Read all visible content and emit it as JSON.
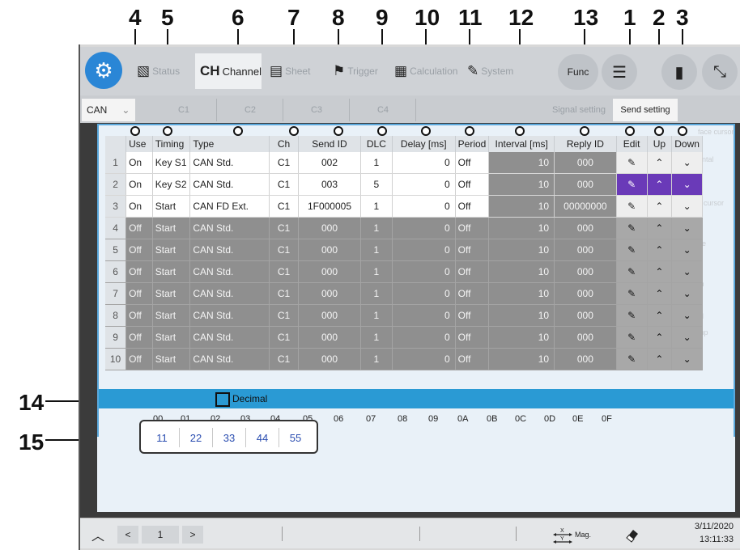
{
  "callouts": {
    "top": [
      "4",
      "5",
      "6",
      "7",
      "8",
      "9",
      "10",
      "11",
      "12",
      "13",
      "1",
      "2",
      "3"
    ],
    "c14": "14",
    "c15": "15"
  },
  "topbar": {
    "gear_icon": "gear-icon",
    "tabs": [
      {
        "icon": "▧",
        "label": "Status"
      },
      {
        "icon": "CH",
        "label": "Channel"
      },
      {
        "icon": "▤",
        "label": "Sheet"
      },
      {
        "icon": "⚑",
        "label": "Trigger"
      },
      {
        "icon": "▦",
        "label": "Calculation"
      },
      {
        "icon": "✎",
        "label": "System"
      }
    ],
    "func_label": "Func",
    "menu_icon": "☰",
    "file_icon": "▮",
    "expand_icon": "⤡"
  },
  "chanrow": {
    "select_value": "CAN",
    "tabs": [
      "C1",
      "C2",
      "C3",
      "C4"
    ],
    "signal_label": "Signal setting",
    "send_label": "Send setting"
  },
  "right_ghost": [
    "face cursor",
    "ontal",
    "y cursor",
    "ge",
    "m",
    "al",
    "e",
    "mp"
  ],
  "table": {
    "headers": [
      "",
      "Use",
      "Timing",
      "Type",
      "Ch",
      "Send ID",
      "DLC",
      "Delay [ms]",
      "Period",
      "Interval [ms]",
      "Reply ID",
      "Edit",
      "Up",
      "Down"
    ],
    "rows": [
      {
        "n": "1",
        "use": "On",
        "timing": "Key S1",
        "type": "CAN Std.",
        "ch": "C1",
        "sid": "002",
        "dlc": "1",
        "delay": "0",
        "period": "Off",
        "interval": "10",
        "rid": "000"
      },
      {
        "n": "2",
        "use": "On",
        "timing": "Key S2",
        "type": "CAN Std.",
        "ch": "C1",
        "sid": "003",
        "dlc": "5",
        "delay": "0",
        "period": "Off",
        "interval": "10",
        "rid": "000"
      },
      {
        "n": "3",
        "use": "On",
        "timing": "Start",
        "type": "CAN FD Ext.",
        "ch": "C1",
        "sid": "1F000005",
        "dlc": "1",
        "delay": "0",
        "period": "Off",
        "interval": "10",
        "rid": "00000000"
      },
      {
        "n": "4",
        "use": "Off",
        "timing": "Start",
        "type": "CAN Std.",
        "ch": "C1",
        "sid": "000",
        "dlc": "1",
        "delay": "0",
        "period": "Off",
        "interval": "10",
        "rid": "000"
      },
      {
        "n": "5",
        "use": "Off",
        "timing": "Start",
        "type": "CAN Std.",
        "ch": "C1",
        "sid": "000",
        "dlc": "1",
        "delay": "0",
        "period": "Off",
        "interval": "10",
        "rid": "000"
      },
      {
        "n": "6",
        "use": "Off",
        "timing": "Start",
        "type": "CAN Std.",
        "ch": "C1",
        "sid": "000",
        "dlc": "1",
        "delay": "0",
        "period": "Off",
        "interval": "10",
        "rid": "000"
      },
      {
        "n": "7",
        "use": "Off",
        "timing": "Start",
        "type": "CAN Std.",
        "ch": "C1",
        "sid": "000",
        "dlc": "1",
        "delay": "0",
        "period": "Off",
        "interval": "10",
        "rid": "000"
      },
      {
        "n": "8",
        "use": "Off",
        "timing": "Start",
        "type": "CAN Std.",
        "ch": "C1",
        "sid": "000",
        "dlc": "1",
        "delay": "0",
        "period": "Off",
        "interval": "10",
        "rid": "000"
      },
      {
        "n": "9",
        "use": "Off",
        "timing": "Start",
        "type": "CAN Std.",
        "ch": "C1",
        "sid": "000",
        "dlc": "1",
        "delay": "0",
        "period": "Off",
        "interval": "10",
        "rid": "000"
      },
      {
        "n": "10",
        "use": "Off",
        "timing": "Start",
        "type": "CAN Std.",
        "ch": "C1",
        "sid": "000",
        "dlc": "1",
        "delay": "0",
        "period": "Off",
        "interval": "10",
        "rid": "000"
      }
    ],
    "edit_icon": "✎",
    "up_icon": "⌃",
    "down_icon": "⌄"
  },
  "data": {
    "decimal_label": "Decimal",
    "hex_headers": [
      "00",
      "01",
      "02",
      "03",
      "04",
      "05",
      "06",
      "07",
      "08",
      "09",
      "0A",
      "0B",
      "0C",
      "0D",
      "0E",
      "0F"
    ],
    "bytes": [
      "11",
      "22",
      "33",
      "44",
      "55"
    ]
  },
  "bottom": {
    "collapse_icon": "︿",
    "prev": "<",
    "page": "1",
    "next": ">",
    "mag_label": "Mag.",
    "eraser_icon": "eraser-icon",
    "date": "3/11/2020",
    "time": "13:11:33"
  },
  "colors": {
    "accent": "#2a9ad4",
    "selected": "#6a3ab8",
    "gear": "#2a86d6"
  }
}
